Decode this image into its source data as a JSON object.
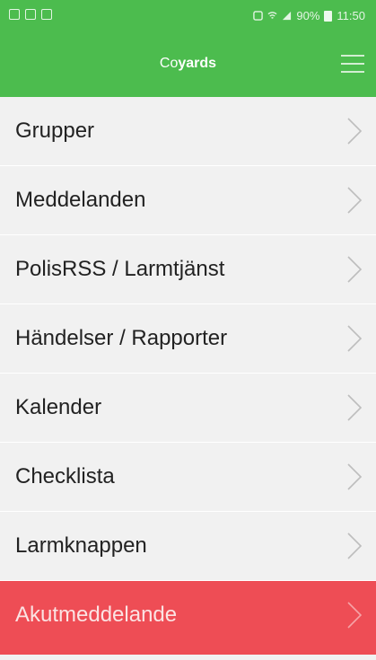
{
  "status_bar": {
    "battery": "90%",
    "time": "11:50",
    "left_icons": [
      "notification-icon",
      "image-icon",
      "gallery-icon"
    ]
  },
  "header": {
    "title_prefix": "Co",
    "title_suffix": "yards",
    "background_color": "#4cbc4e"
  },
  "menu": {
    "items": [
      {
        "label": "Grupper"
      },
      {
        "label": "Meddelanden"
      },
      {
        "label": "PolisRSS / Larmtjänst"
      },
      {
        "label": "Händelser / Rapporter"
      },
      {
        "label": "Kalender"
      },
      {
        "label": "Checklista"
      },
      {
        "label": "Larmknappen"
      },
      {
        "label": "Akutmeddelande",
        "accent_color": "#ee4d55"
      }
    ],
    "chevron_icon": "chevron-right-icon"
  }
}
